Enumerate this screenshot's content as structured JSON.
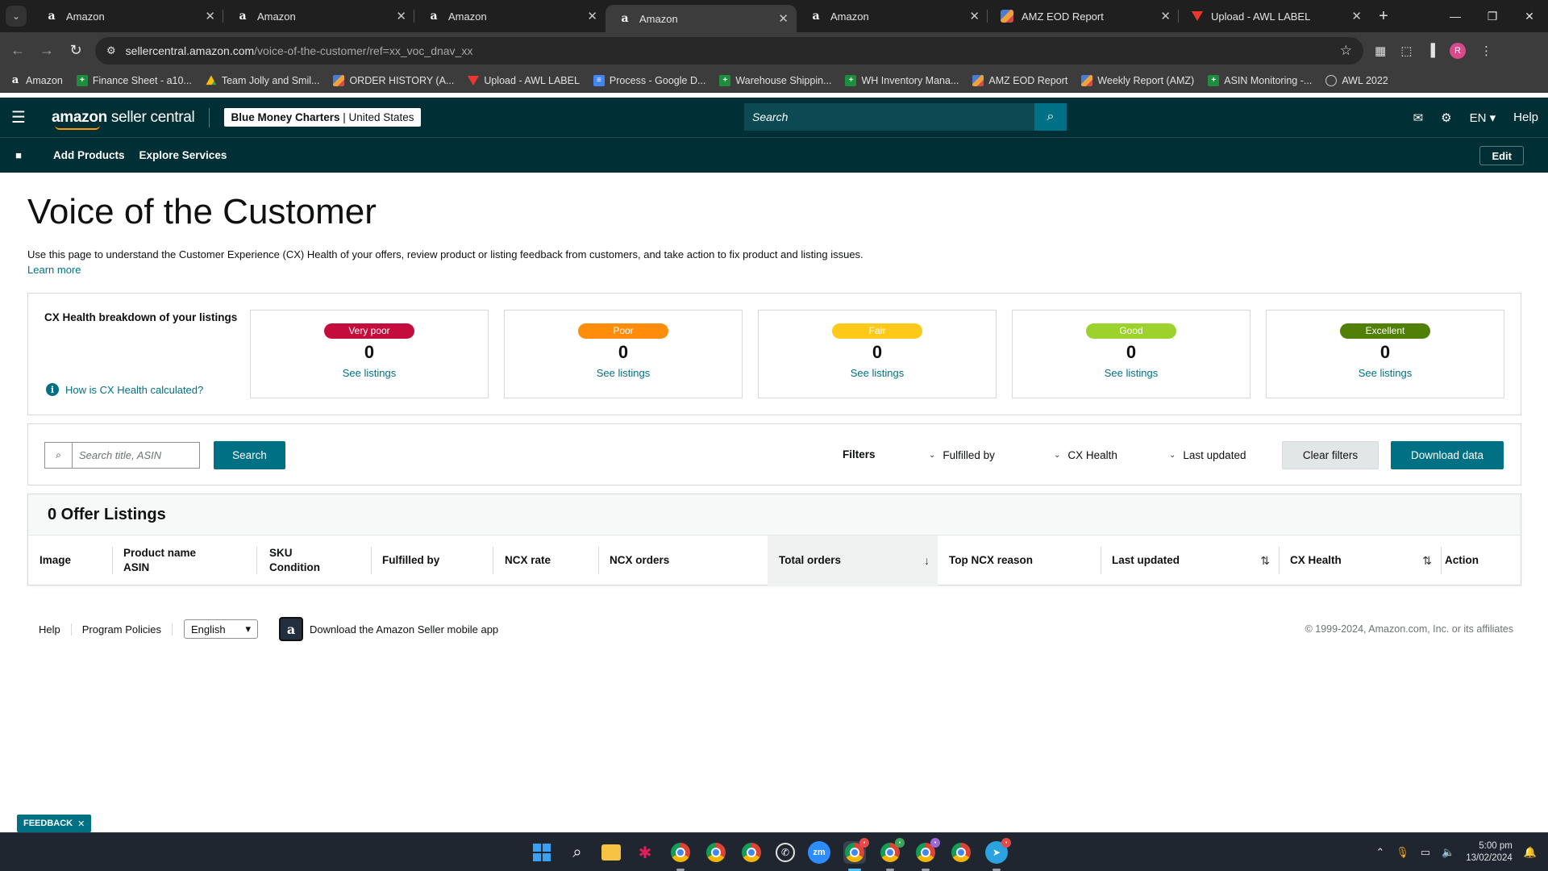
{
  "browser": {
    "tabs": [
      {
        "label": "Amazon",
        "icon": "amazon-icon",
        "active": false
      },
      {
        "label": "Amazon",
        "icon": "amazon-icon",
        "active": false
      },
      {
        "label": "Amazon",
        "icon": "amazon-icon",
        "active": false
      },
      {
        "label": "Amazon",
        "icon": "amazon-icon",
        "active": true
      },
      {
        "label": "Amazon",
        "icon": "amazon-icon",
        "active": false
      },
      {
        "label": "AMZ EOD Report",
        "icon": "eod-report-icon",
        "active": false
      },
      {
        "label": "Upload - AWL LABEL",
        "icon": "awl-label-icon",
        "active": false
      }
    ],
    "url_host": "sellercentral.amazon.com",
    "url_path": "/voice-of-the-customer/ref=xx_voc_dnav_xx",
    "profile_initial": "R",
    "bookmarks": [
      {
        "label": "Amazon",
        "icon": "amz"
      },
      {
        "label": "Finance Sheet - a10...",
        "icon": "sheet"
      },
      {
        "label": "Team Jolly and Smil...",
        "icon": "drive"
      },
      {
        "label": "ORDER HISTORY (A...",
        "icon": "eod"
      },
      {
        "label": "Upload - AWL LABEL",
        "icon": "awl"
      },
      {
        "label": "Process - Google D...",
        "icon": "docs"
      },
      {
        "label": "Warehouse Shippin...",
        "icon": "sheet"
      },
      {
        "label": "WH Inventory Mana...",
        "icon": "sheet"
      },
      {
        "label": "AMZ EOD Report",
        "icon": "eod"
      },
      {
        "label": "Weekly Report (AMZ)",
        "icon": "eod"
      },
      {
        "label": "ASIN Monitoring -...",
        "icon": "sheet"
      },
      {
        "label": "AWL 2022",
        "icon": "globe"
      }
    ]
  },
  "header": {
    "logo_bold": "amazon",
    "logo_rest": " seller central",
    "store_name": "Blue Money Charters",
    "marketplace": "United States",
    "search_placeholder": "Search",
    "lang": "EN",
    "help": "Help"
  },
  "subnav": {
    "add_products": "Add Products",
    "explore_services": "Explore Services",
    "edit": "Edit"
  },
  "page": {
    "title": "Voice of the Customer",
    "description": "Use this page to understand the Customer Experience (CX) Health of your offers, review product or listing feedback from customers, and take action to fix product and listing issues.",
    "learn_more": "Learn more"
  },
  "cx_health": {
    "heading": "CX Health breakdown of your listings",
    "how_link": "How is CX Health calculated?",
    "cards": [
      {
        "label": "Very poor",
        "count": "0",
        "link": "See listings",
        "color": "#c40d3c"
      },
      {
        "label": "Poor",
        "count": "0",
        "link": "See listings",
        "color": "#ff8c0a"
      },
      {
        "label": "Fair",
        "count": "0",
        "link": "See listings",
        "color": "#ffc91a"
      },
      {
        "label": "Good",
        "count": "0",
        "link": "See listings",
        "color": "#9bd22b"
      },
      {
        "label": "Excellent",
        "count": "0",
        "link": "See listings",
        "color": "#508005"
      }
    ]
  },
  "filters": {
    "search_placeholder": "Search title, ASIN",
    "search_button": "Search",
    "label": "Filters",
    "fulfilled_by": "Fulfilled by",
    "cx_health": "CX Health",
    "last_updated": "Last updated",
    "clear": "Clear filters",
    "download": "Download data"
  },
  "listings": {
    "heading": "0 Offer Listings",
    "columns": {
      "image": "Image",
      "product_name": "Product name",
      "asin": "ASIN",
      "sku": "SKU",
      "condition": "Condition",
      "fulfilled_by": "Fulfilled by",
      "ncx_rate": "NCX rate",
      "ncx_orders": "NCX orders",
      "total_orders": "Total orders",
      "top_ncx_reason": "Top NCX reason",
      "last_updated": "Last updated",
      "cx_health": "CX Health",
      "action": "Action"
    }
  },
  "footer": {
    "help": "Help",
    "program_policies": "Program Policies",
    "language": "English",
    "app_text": "Download the Amazon Seller mobile app",
    "copyright": "© 1999-2024, Amazon.com, Inc. or its affiliates"
  },
  "feedback": "FEEDBACK",
  "taskbar": {
    "time": "5:00 pm",
    "date": "13/02/2024",
    "zoom_label": "zm"
  },
  "colors": {
    "header_bg": "#002f36",
    "primary_button": "#007185",
    "link": "#007185"
  }
}
